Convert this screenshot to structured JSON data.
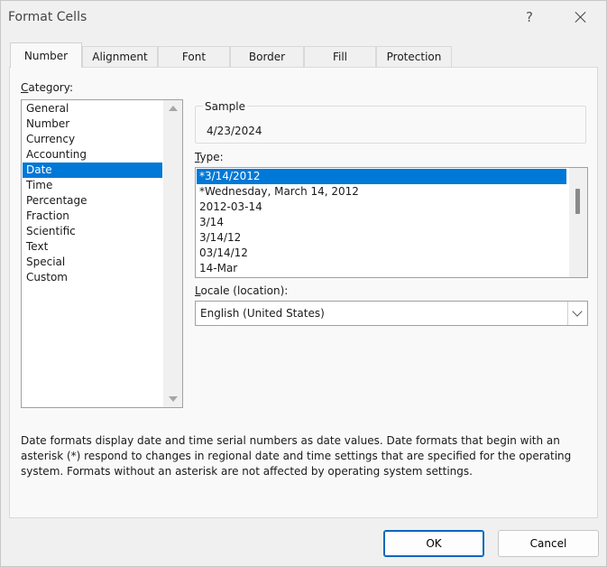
{
  "window": {
    "title": "Format Cells",
    "help": "?",
    "close": "close"
  },
  "tabs": [
    {
      "label": "Number",
      "active": true
    },
    {
      "label": "Alignment"
    },
    {
      "label": "Font"
    },
    {
      "label": "Border"
    },
    {
      "label": "Fill"
    },
    {
      "label": "Protection"
    }
  ],
  "category": {
    "label_u": "C",
    "label_rest": "ategory:",
    "items": [
      "General",
      "Number",
      "Currency",
      "Accounting",
      "Date",
      "Time",
      "Percentage",
      "Fraction",
      "Scientific",
      "Text",
      "Special",
      "Custom"
    ],
    "selected": "Date"
  },
  "sample": {
    "label": "Sample",
    "value": "4/23/2024"
  },
  "type": {
    "label_u": "T",
    "label_rest": "ype:",
    "items": [
      "*3/14/2012",
      "*Wednesday, March 14, 2012",
      "2012-03-14",
      "3/14",
      "3/14/12",
      "03/14/12",
      "14-Mar"
    ],
    "selected": "*3/14/2012"
  },
  "locale": {
    "label_u": "L",
    "label_rest": "ocale (location):",
    "value": "English (United States)"
  },
  "description": "Date formats display date and time serial numbers as date values.  Date formats that begin with an asterisk (*) respond to changes in regional date and time settings that are specified for the operating system. Formats without an asterisk are not affected by operating system settings.",
  "buttons": {
    "ok": "OK",
    "cancel": "Cancel"
  },
  "colors": {
    "selection": "#0078d7",
    "primary_border": "#0067c0"
  }
}
